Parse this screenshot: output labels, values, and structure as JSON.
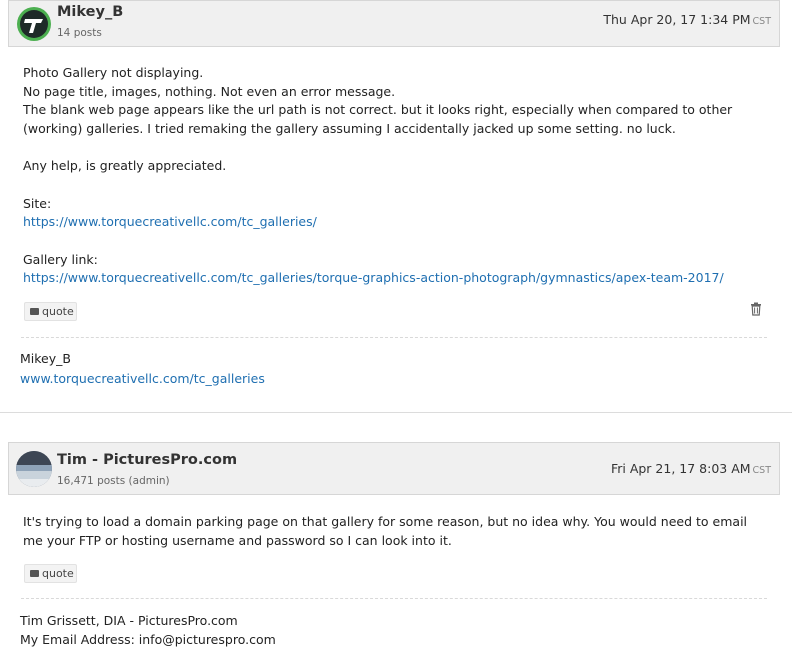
{
  "posts": [
    {
      "author": "Mikey_B",
      "post_count": "14 posts",
      "date": "Thu Apr 20, 17 1:34 PM",
      "tz": "CST",
      "body": [
        "Photo Gallery not displaying.",
        "No page title, images, nothing. Not even an error message.",
        "The blank web page appears like the url path is not correct. but it looks right, especially when compared to other",
        "(working) galleries. I tried remaking the gallery assuming I accidentally jacked up some setting. no luck.",
        "Any help, is greatly appreciated.",
        "Site:",
        "https://www.torquecreativellc.com/tc_galleries/",
        "Gallery link:",
        "https://www.torquecreativellc.com/tc_galleries/torque-graphics-action-photograph/gymnastics/apex-team-2017/"
      ],
      "quote_label": "quote",
      "signature": [
        "Mikey_B",
        "www.torquecreativellc.com/tc_galleries"
      ]
    },
    {
      "author": "Tim - PicturesPro.com",
      "post_count": "16,471 posts (admin)",
      "date": "Fri Apr 21, 17 8:03 AM",
      "tz": "CST",
      "body": [
        "It's trying to load a domain parking page on that gallery for some reason, but no idea why. You would need to email",
        "me your FTP or hosting username and password so I can look into it."
      ],
      "quote_label": "quote",
      "signature": [
        "Tim Grissett, DIA - PicturesPro.com",
        "My Email Address: info@picturespro.com"
      ]
    }
  ],
  "colors": {
    "link": "#1f6fb1",
    "header_bg": "#f0f0f0",
    "avatar1_ring": "#4caf50"
  },
  "icons": [
    "logo-avatar-icon",
    "quote-icon",
    "trash-icon"
  ]
}
